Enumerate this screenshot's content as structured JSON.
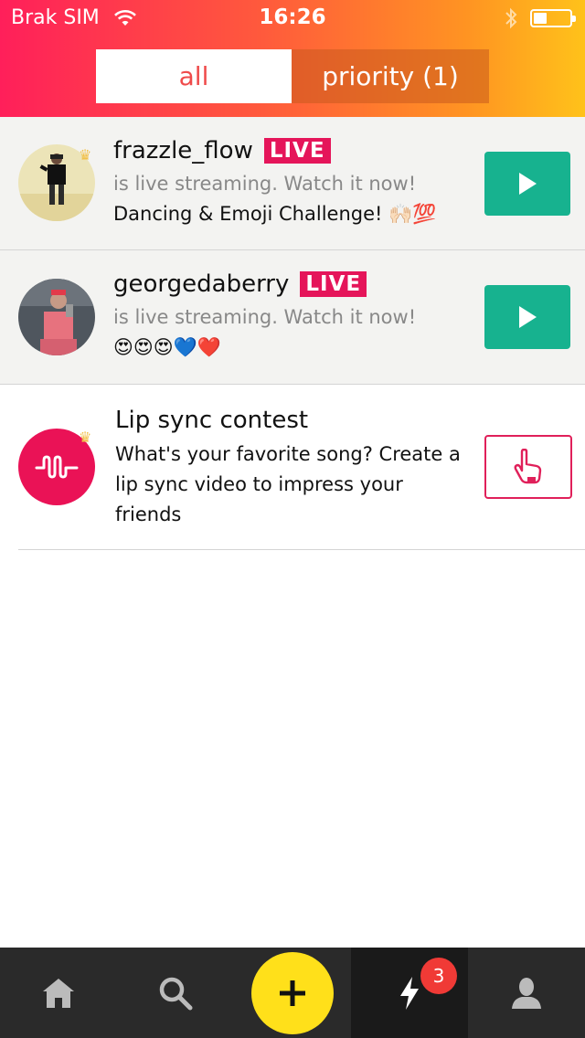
{
  "status_bar": {
    "carrier": "Brak SIM",
    "time": "16:26",
    "battery_percent": 25
  },
  "tabs": [
    {
      "label": "all",
      "active": true
    },
    {
      "label": "priority (1)",
      "active": false
    }
  ],
  "feed": [
    {
      "username": "frazzle_flow",
      "badge": "LIVE",
      "subtitle": "is live streaming. Watch it now!",
      "caption": "Dancing & Emoji Challenge! 🙌🏻💯"
    },
    {
      "username": "georgedaberry",
      "badge": "LIVE",
      "subtitle": "is live streaming. Watch it now!",
      "caption": "😍😍😍💙❤️"
    }
  ],
  "contest": {
    "title": "Lip sync contest",
    "description": "What's your favorite song? Create a lip sync video to impress your friends"
  },
  "bottom_nav": {
    "notification_count": "3",
    "items": [
      "home-icon",
      "search-icon",
      "plus-icon",
      "lightning-icon",
      "profile-icon"
    ]
  },
  "colors": {
    "live_badge": "#e5155a",
    "play_button": "#17b28f",
    "brand_pink": "#ea1256",
    "plus_button": "#ffe01a"
  }
}
